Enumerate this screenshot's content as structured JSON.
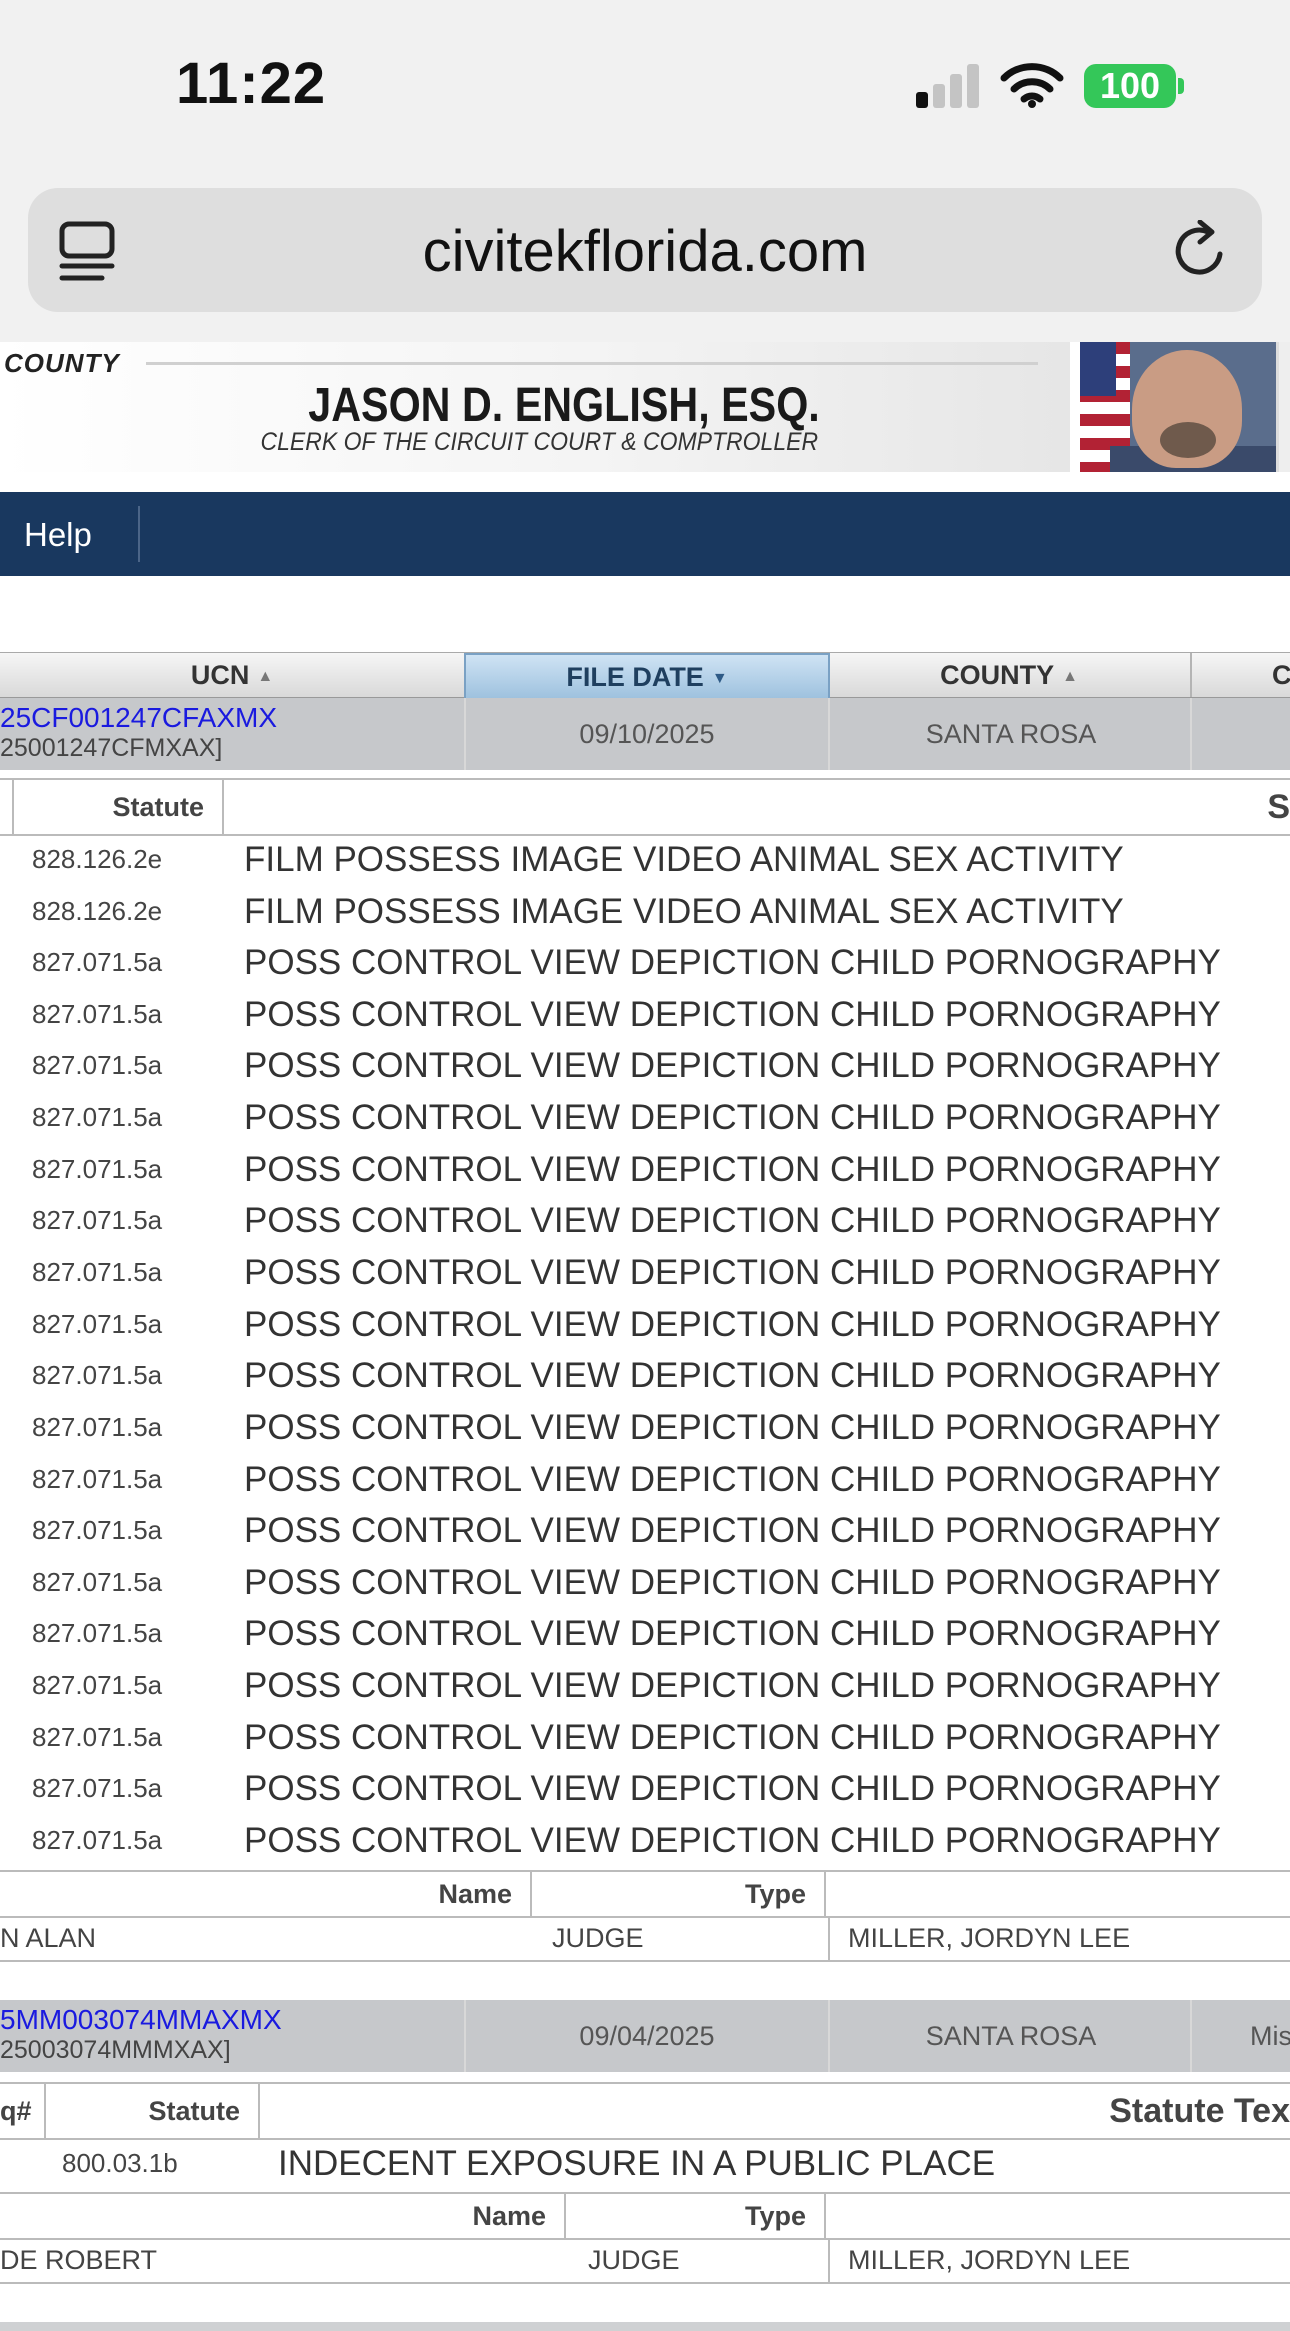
{
  "status_bar": {
    "time": "11:22",
    "battery": "100"
  },
  "browser": {
    "url": "civitekflorida.com"
  },
  "banner": {
    "county": "COUNTY",
    "clerk_name": "JASON D. ENGLISH, ESQ.",
    "clerk_title": "CLERK OF THE CIRCUIT COURT & COMPTROLLER"
  },
  "nav": {
    "help": "Help"
  },
  "grid": {
    "headers": {
      "ucn": "UCN",
      "file_date": "FILE DATE",
      "county": "COUNTY",
      "next": "C"
    }
  },
  "cases": [
    {
      "ucn": "25CF001247CFAXMX",
      "ucn_alt": "25001247CFMXAX]",
      "file_date": "09/10/2025",
      "county": "SANTA ROSA",
      "extra": "",
      "charge_headers": {
        "seq": "",
        "statute": "Statute",
        "text": "S"
      },
      "charges": [
        {
          "statute": "828.126.2e",
          "text": "FILM POSSESS IMAGE VIDEO ANIMAL SEX ACTIVITY"
        },
        {
          "statute": "828.126.2e",
          "text": "FILM POSSESS IMAGE VIDEO ANIMAL SEX ACTIVITY"
        },
        {
          "statute": "827.071.5a",
          "text": "POSS CONTROL VIEW DEPICTION CHILD PORNOGRAPHY"
        },
        {
          "statute": "827.071.5a",
          "text": "POSS CONTROL VIEW DEPICTION CHILD PORNOGRAPHY"
        },
        {
          "statute": "827.071.5a",
          "text": "POSS CONTROL VIEW DEPICTION CHILD PORNOGRAPHY"
        },
        {
          "statute": "827.071.5a",
          "text": "POSS CONTROL VIEW DEPICTION CHILD PORNOGRAPHY"
        },
        {
          "statute": "827.071.5a",
          "text": "POSS CONTROL VIEW DEPICTION CHILD PORNOGRAPHY"
        },
        {
          "statute": "827.071.5a",
          "text": "POSS CONTROL VIEW DEPICTION CHILD PORNOGRAPHY"
        },
        {
          "statute": "827.071.5a",
          "text": "POSS CONTROL VIEW DEPICTION CHILD PORNOGRAPHY"
        },
        {
          "statute": "827.071.5a",
          "text": "POSS CONTROL VIEW DEPICTION CHILD PORNOGRAPHY"
        },
        {
          "statute": "827.071.5a",
          "text": "POSS CONTROL VIEW DEPICTION CHILD PORNOGRAPHY"
        },
        {
          "statute": "827.071.5a",
          "text": "POSS CONTROL VIEW DEPICTION CHILD PORNOGRAPHY"
        },
        {
          "statute": "827.071.5a",
          "text": "POSS CONTROL VIEW DEPICTION CHILD PORNOGRAPHY"
        },
        {
          "statute": "827.071.5a",
          "text": "POSS CONTROL VIEW DEPICTION CHILD PORNOGRAPHY"
        },
        {
          "statute": "827.071.5a",
          "text": "POSS CONTROL VIEW DEPICTION CHILD PORNOGRAPHY"
        },
        {
          "statute": "827.071.5a",
          "text": "POSS CONTROL VIEW DEPICTION CHILD PORNOGRAPHY"
        },
        {
          "statute": "827.071.5a",
          "text": "POSS CONTROL VIEW DEPICTION CHILD PORNOGRAPHY"
        },
        {
          "statute": "827.071.5a",
          "text": "POSS CONTROL VIEW DEPICTION CHILD PORNOGRAPHY"
        },
        {
          "statute": "827.071.5a",
          "text": "POSS CONTROL VIEW DEPICTION CHILD PORNOGRAPHY"
        },
        {
          "statute": "827.071.5a",
          "text": "POSS CONTROL VIEW DEPICTION CHILD PORNOGRAPHY"
        }
      ],
      "party_headers": {
        "name": "Name",
        "type": "Type"
      },
      "party": {
        "name": "N ALAN",
        "type": "JUDGE",
        "judge": "MILLER, JORDYN LEE"
      }
    },
    {
      "ucn": "5MM003074MMAXMX",
      "ucn_alt": "25003074MMMXAX]",
      "file_date": "09/04/2025",
      "county": "SANTA ROSA",
      "extra": "Mis",
      "charge_headers": {
        "seq": "q#",
        "statute": "Statute",
        "text": "Statute Tex"
      },
      "charges": [
        {
          "statute": "800.03.1b",
          "text": "INDECENT EXPOSURE IN A PUBLIC PLACE"
        }
      ],
      "party_headers": {
        "name": "Name",
        "type": "Type"
      },
      "party": {
        "name": "DE ROBERT",
        "type": "JUDGE",
        "judge": "MILLER, JORDYN LEE"
      }
    }
  ]
}
